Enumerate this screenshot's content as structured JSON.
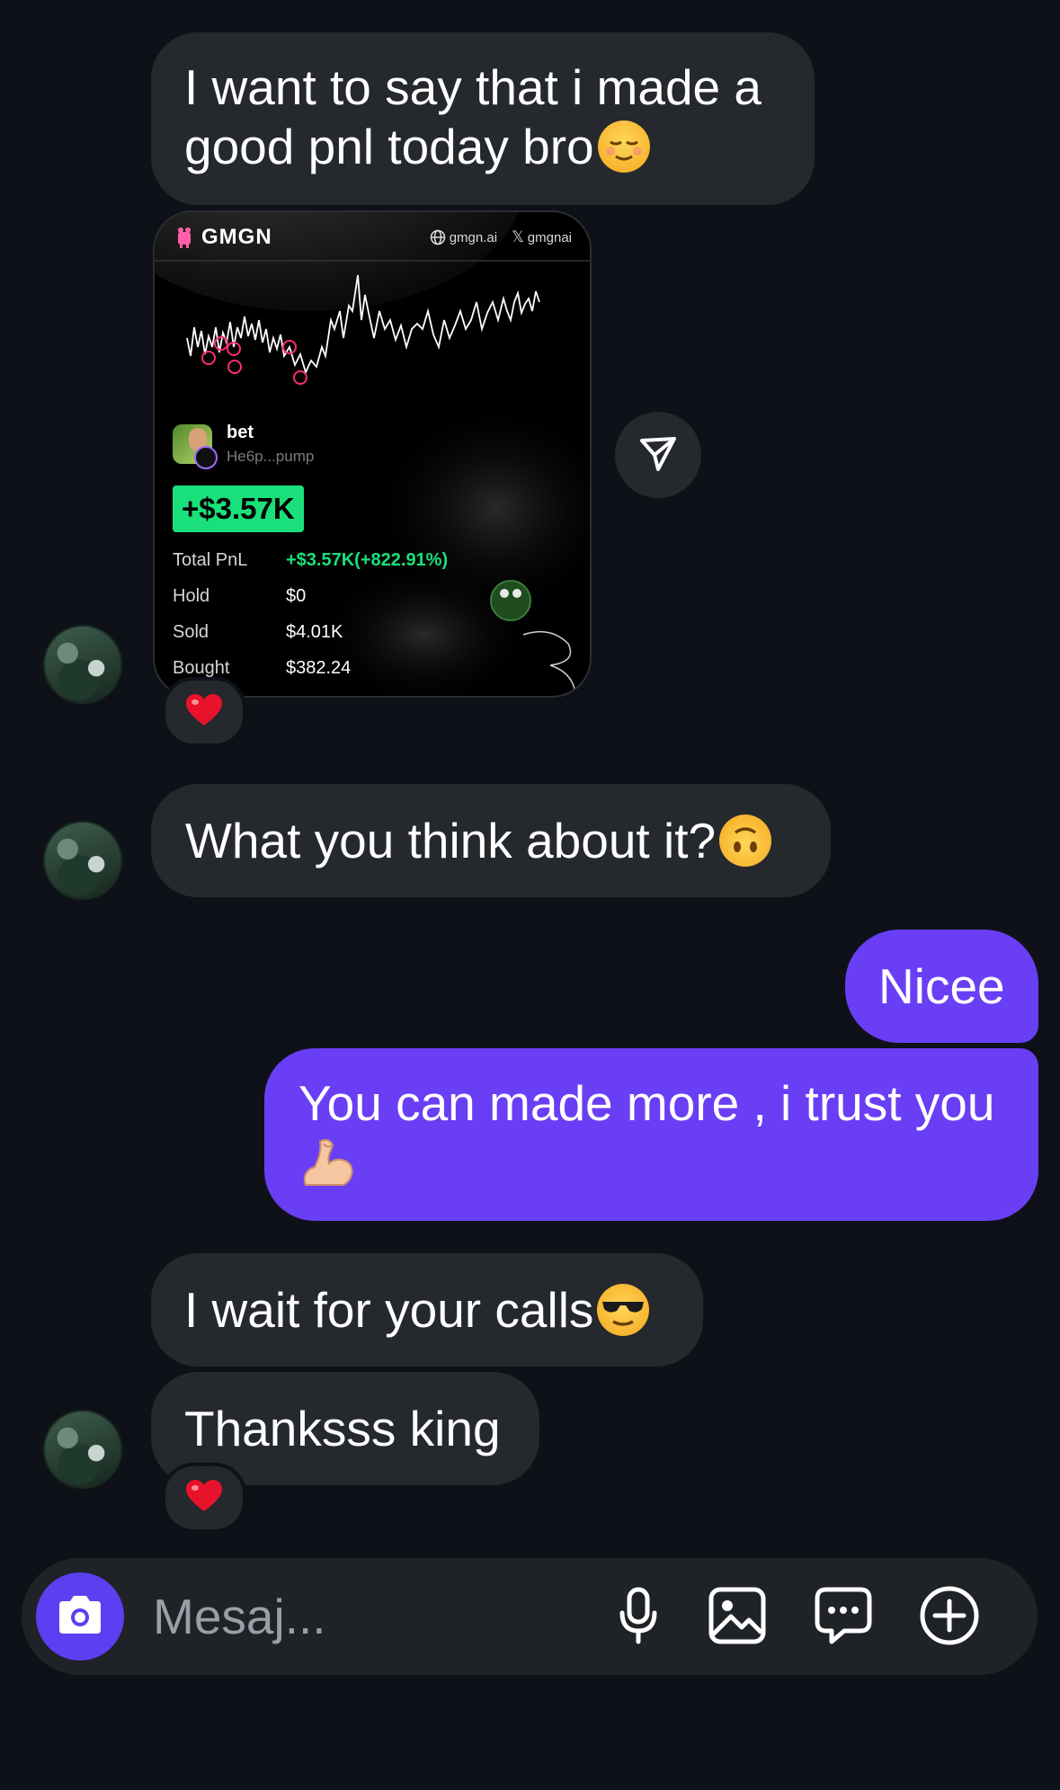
{
  "messages": {
    "m1_line1": "I want to say that i made a",
    "m1_line2": "good pnl today bro",
    "m2": "What you think about it?",
    "m3": "Nicee",
    "m4_line1": "You can made more , i trust you",
    "m5": "I wait for your calls",
    "m6": "Thanksss king"
  },
  "card": {
    "brand": "GMGN",
    "site": "gmgn.ai",
    "handle": "gmgnai",
    "token_name": "bet",
    "token_address": "He6p...pump",
    "pnl_badge": "+$3.57K",
    "rows": [
      {
        "label": "Total PnL",
        "value": "+$3.57K(+822.91%)"
      },
      {
        "label": "Hold",
        "value": "$0"
      },
      {
        "label": "Sold",
        "value": "$4.01K"
      },
      {
        "label": "Bought",
        "value": "$382.24"
      }
    ]
  },
  "composer": {
    "placeholder": "Mesaj..."
  },
  "icons": {
    "camera": "camera-icon",
    "mic": "microphone-icon",
    "image": "image-icon",
    "sticker": "sticker-chat-icon",
    "plus": "plus-circle-icon",
    "share": "share-send-icon",
    "heart": "heart-icon"
  },
  "colors": {
    "background": "#0e1218",
    "incoming_bubble": "#25282d",
    "outgoing_bubble": "#6a3ef5",
    "camera_button": "#5b3ff0",
    "pnl_green": "#19e07a"
  }
}
